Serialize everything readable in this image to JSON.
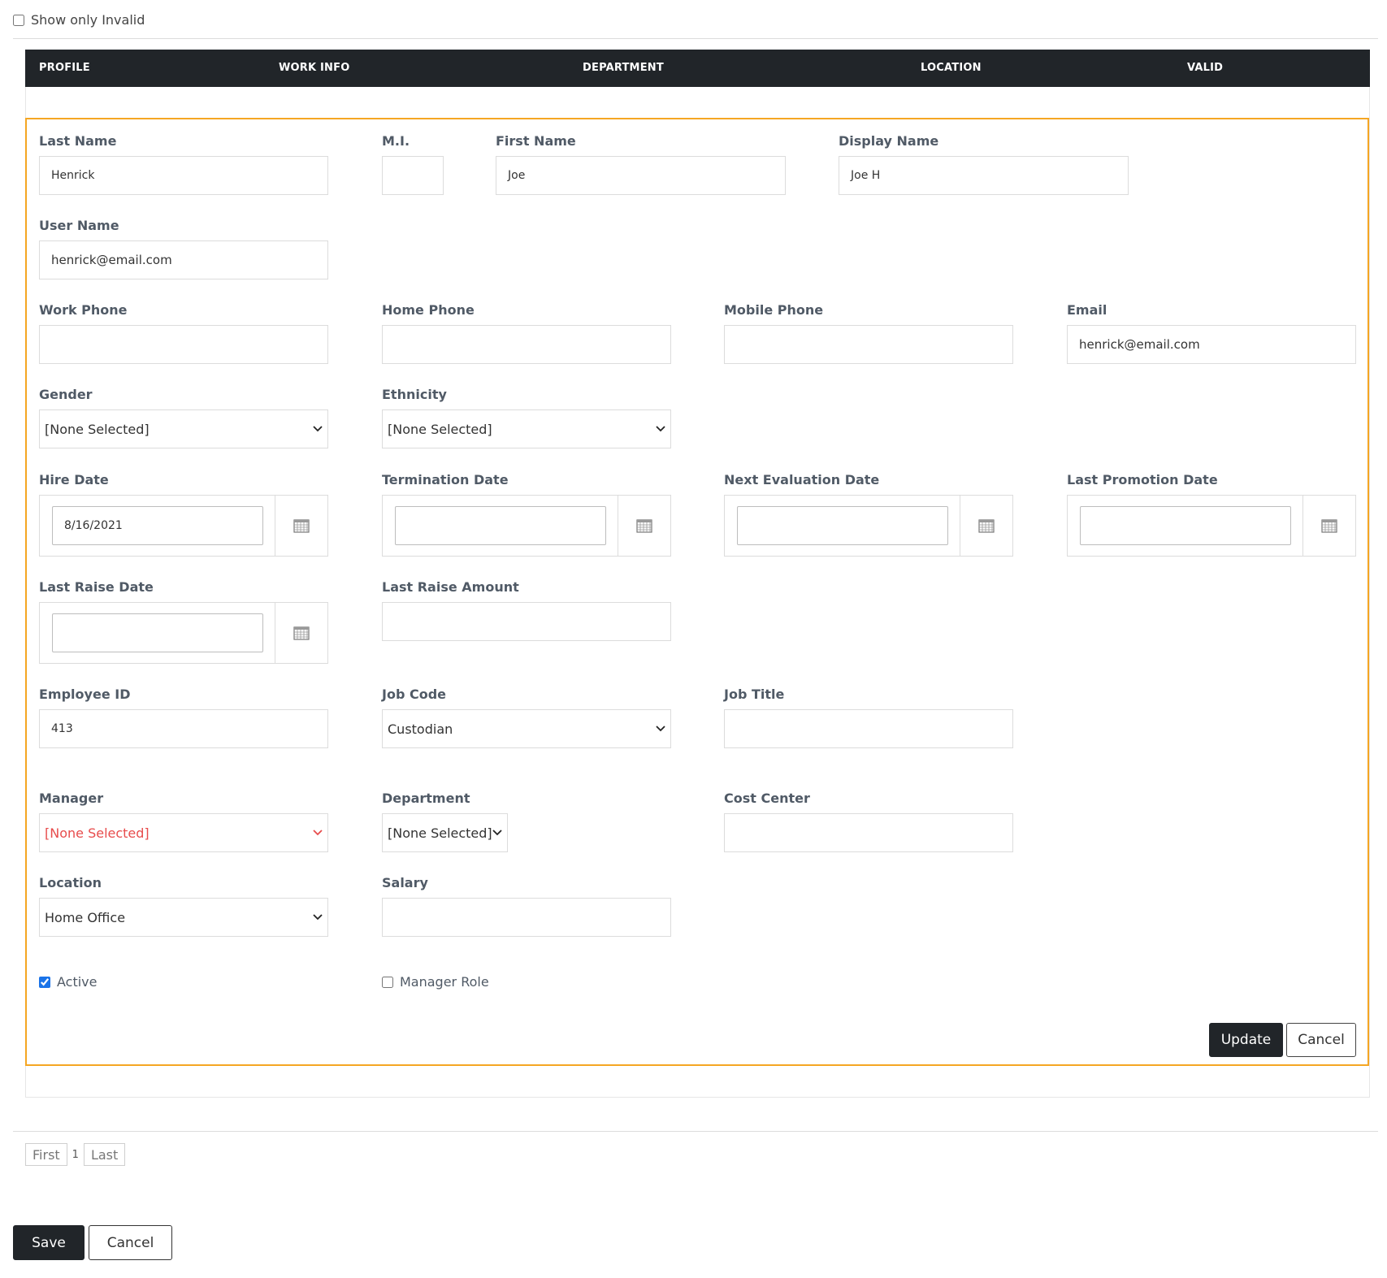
{
  "filter": {
    "show_only_invalid_label": "Show only Invalid",
    "checked": false
  },
  "grid_header": {
    "columns": [
      "PROFILE",
      "WORK INFO",
      "DEPARTMENT",
      "LOCATION",
      "VALID"
    ]
  },
  "form": {
    "last_name": {
      "label": "Last Name",
      "value": "Henrick"
    },
    "mi": {
      "label": "M.I.",
      "value": ""
    },
    "first_name": {
      "label": "First Name",
      "value": "Joe"
    },
    "display_name": {
      "label": "Display Name",
      "value": "Joe H"
    },
    "user_name": {
      "label": "User Name",
      "value": "henrick@email.com"
    },
    "work_phone": {
      "label": "Work Phone",
      "value": ""
    },
    "home_phone": {
      "label": "Home Phone",
      "value": ""
    },
    "mobile_phone": {
      "label": "Mobile Phone",
      "value": ""
    },
    "email": {
      "label": "Email",
      "value": "henrick@email.com"
    },
    "gender": {
      "label": "Gender",
      "value": "[None Selected]"
    },
    "ethnicity": {
      "label": "Ethnicity",
      "value": "[None Selected]"
    },
    "hire_date": {
      "label": "Hire Date",
      "value": "8/16/2021"
    },
    "termination_date": {
      "label": "Termination Date",
      "value": ""
    },
    "next_evaluation_date": {
      "label": "Next Evaluation Date",
      "value": ""
    },
    "last_promotion_date": {
      "label": "Last Promotion Date",
      "value": ""
    },
    "last_raise_date": {
      "label": "Last Raise Date",
      "value": ""
    },
    "last_raise_amount": {
      "label": "Last Raise Amount",
      "value": ""
    },
    "employee_id": {
      "label": "Employee ID",
      "value": "413"
    },
    "job_code": {
      "label": "Job Code",
      "value": "Custodian"
    },
    "job_title": {
      "label": "Job Title",
      "value": ""
    },
    "manager": {
      "label": "Manager",
      "value": "[None Selected]",
      "invalid": true
    },
    "department": {
      "label": "Department",
      "value": "[None Selected]"
    },
    "cost_center": {
      "label": "Cost Center",
      "value": ""
    },
    "location": {
      "label": "Location",
      "value": "Home Office"
    },
    "salary": {
      "label": "Salary",
      "value": ""
    },
    "active": {
      "label": "Active",
      "checked": true
    },
    "manager_role": {
      "label": "Manager Role",
      "checked": false
    },
    "update_label": "Update",
    "cancel_label": "Cancel"
  },
  "pager": {
    "first_label": "First",
    "page": "1",
    "last_label": "Last"
  },
  "footer": {
    "save_label": "Save",
    "cancel_label": "Cancel"
  },
  "colors": {
    "header_bg": "#212529",
    "form_border": "#f5a623",
    "invalid_text": "#e74c4c",
    "checkbox_accent": "#1a73e8"
  },
  "icons": {
    "calendar": "calendar-icon",
    "chevron": "chevron-down-icon"
  }
}
